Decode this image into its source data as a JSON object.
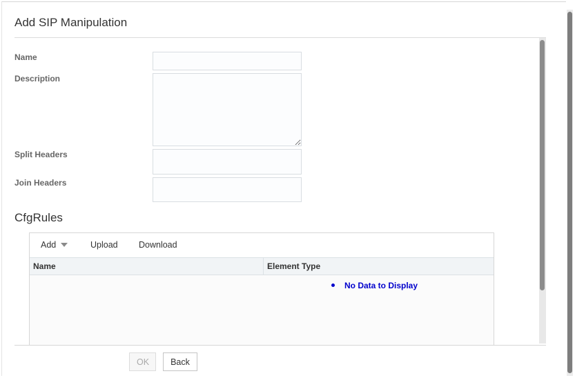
{
  "dialog": {
    "title": "Add SIP Manipulation"
  },
  "form": {
    "name": {
      "label": "Name",
      "value": "",
      "placeholder": ""
    },
    "description": {
      "label": "Description",
      "value": "",
      "placeholder": ""
    },
    "split_headers": {
      "label": "Split Headers",
      "value": "",
      "placeholder": ""
    },
    "join_headers": {
      "label": "Join Headers",
      "value": "",
      "placeholder": ""
    }
  },
  "cfg_rules": {
    "title": "CfgRules",
    "toolbar": {
      "add_label": "Add",
      "upload_label": "Upload",
      "download_label": "Download"
    },
    "columns": [
      "Name",
      "Element Type"
    ],
    "empty_text": "No Data to Display"
  },
  "footer": {
    "ok_label": "OK",
    "back_label": "Back"
  },
  "colors": {
    "empty_text": "#0000cc",
    "header_bg": "#f1f4f6"
  }
}
